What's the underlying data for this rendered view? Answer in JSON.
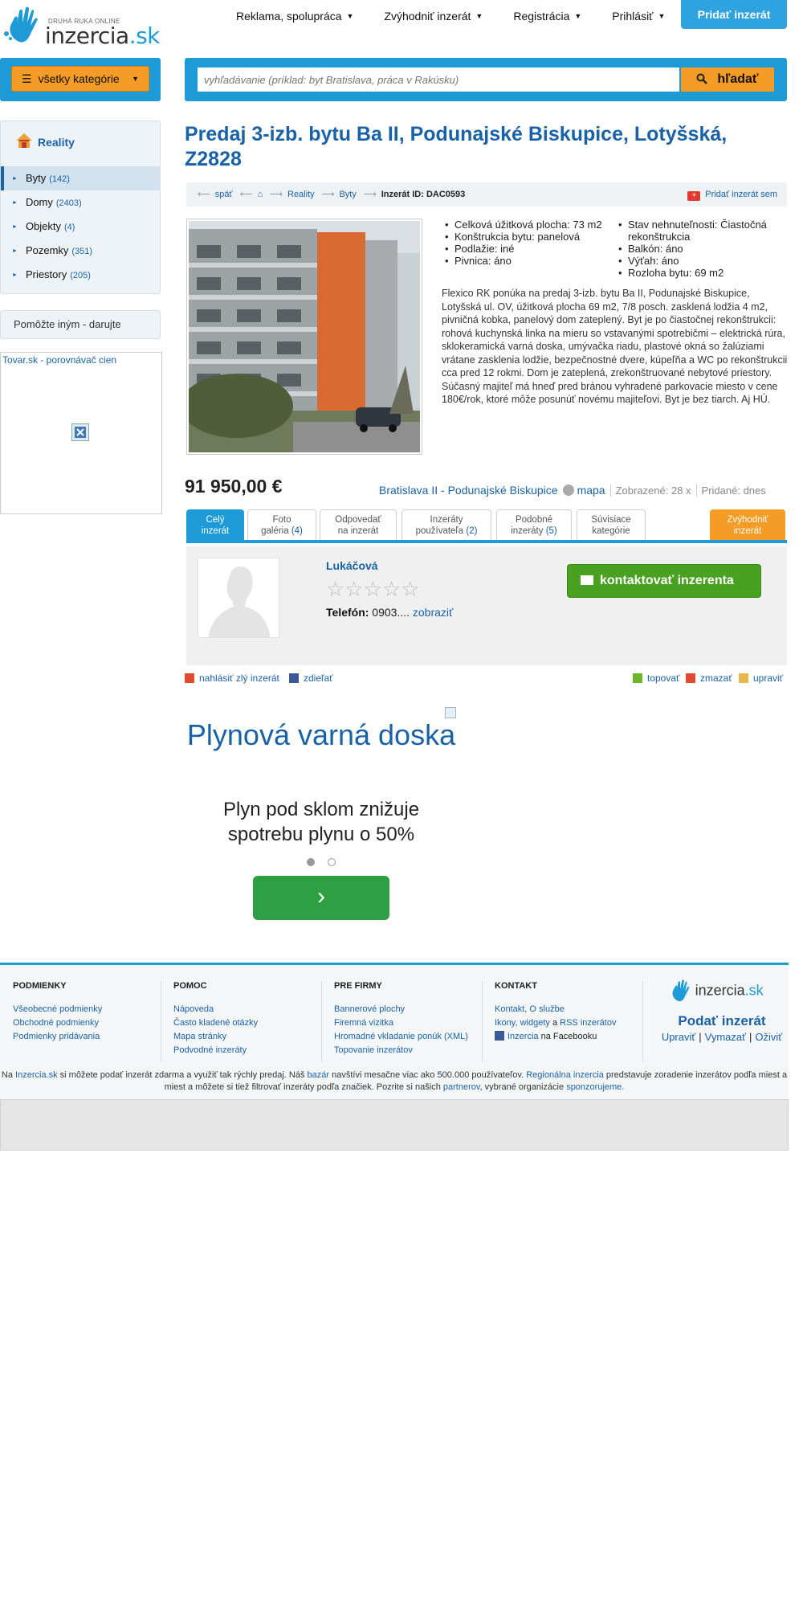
{
  "logo": {
    "tagline": "DRUHÁ RUKA ONLINE",
    "name": "inzercia",
    "tld": ".sk"
  },
  "nav": {
    "items": [
      {
        "label": "Reklama, spolupráca"
      },
      {
        "label": "Zvýhodniť inzerát"
      },
      {
        "label": "Registrácia"
      },
      {
        "label": "Prihlásiť"
      }
    ],
    "add_button": "Pridať inzerát"
  },
  "search": {
    "category_button": "všetky kategórie",
    "placeholder": "vyhľadávanie (príklad: byt Bratislava, práca v Rakúsku)",
    "button": "hľadať"
  },
  "sidebar": {
    "heading": "Reality",
    "items": [
      {
        "label": "Byty",
        "count": "(142)"
      },
      {
        "label": "Domy",
        "count": "(2403)"
      },
      {
        "label": "Objekty",
        "count": "(4)"
      },
      {
        "label": "Pozemky",
        "count": "(351)"
      },
      {
        "label": "Priestory",
        "count": "(205)"
      }
    ],
    "donate": "Pomôžte iným - darujte",
    "tovar_link": "Tovar.sk - porovnávač cien"
  },
  "listing": {
    "title": "Predaj 3-izb. bytu Ba II, Podunajské Biskupice, Lotyšská, Z2828",
    "breadcrumb": {
      "back": "späť",
      "home": "⌂",
      "reality": "Reality",
      "byty": "Byty",
      "id": "Inzerát ID: DAC0593",
      "add": "Pridať inzerát sem"
    },
    "params_left": [
      "Celková úžitková plocha: 73 m2",
      "Konštrukcia bytu: panelová",
      "Podlažie: iné",
      "Pivnica: áno"
    ],
    "params_right": [
      "Stav nehnuteľnosti: Čiastočná rekonštrukcia",
      "Balkón: áno",
      "Výťah: áno",
      "Rozloha bytu: 69 m2"
    ],
    "description": "Flexico RK ponúka na predaj 3-izb. bytu Ba II, Podunajské Biskupice, Lotyšská ul. OV, úžitková plocha 69 m2, 7/8 posch. zasklená lodžia 4 m2, pivničná kobka, panelový dom zateplený. Byt je po čiastočnej rekonštrukcii: rohová kuchynská linka na mieru so vstavanými spotrebičmi – elektrická rúra, sklokeramická varná doska, umývačka riadu, plastové okná so žalúziami vrátane zasklenia lodžie, bezpečnostné dvere, kúpeľňa a WC po rekonštrukcii cca pred 12 rokmi. Dom je zateplená, zrekonštruované nebytové priestory. Súčasný majiteľ má hneď pred bránou vyhradené parkovacie miesto v cene 180€/rok, ktoré môže posunúť novému majiteľovi. Byt je bez tiarch. Aj HÚ.",
    "price": "91 950,00 €",
    "location": "Bratislava II - Podunajské Biskupice",
    "map": "mapa",
    "views": "Zobrazené: 28 x",
    "added": "Pridané: dnes"
  },
  "tabs": [
    {
      "line1": "Celý",
      "line2": "inzerát",
      "count": ""
    },
    {
      "line1": "Foto",
      "line2": "galéria ",
      "count": "(4)"
    },
    {
      "line1": "Odpovedať",
      "line2": "na inzerát",
      "count": ""
    },
    {
      "line1": "Inzeráty",
      "line2": "používateľa ",
      "count": "(2)"
    },
    {
      "line1": "Podobné",
      "line2": "inzeráty ",
      "count": "(5)"
    },
    {
      "line1": "Súvisiace",
      "line2": "kategórie",
      "count": ""
    },
    {
      "line1": "Zvýhodniť",
      "line2": "inzerát",
      "count": ""
    }
  ],
  "seller": {
    "name": "Lukáčová",
    "stars": "☆☆☆☆☆",
    "phone_label": "Telefón:",
    "phone_value": "0903....",
    "phone_show": "zobraziť",
    "contact_button": "kontaktovať inzerenta"
  },
  "actions": {
    "report": "nahlásiť zlý inzerát",
    "share": "zdieľať",
    "top": "topovať",
    "delete": "zmazať",
    "edit": "upraviť"
  },
  "ad": {
    "title": "Plynová varná doska",
    "subtitle": "Plyn pod sklom znižuje spotrebu plynu o 50%",
    "arrow": "›"
  },
  "footer": {
    "columns": [
      {
        "heading": "PODMIENKY",
        "links": [
          "Všeobecné podmienky",
          "Obchodné podmienky",
          "Podmienky pridávania"
        ]
      },
      {
        "heading": "POMOC",
        "links": [
          "Nápoveda",
          "Často kladené otázky",
          "Mapa stránky",
          "Podvodné inzeráty"
        ]
      },
      {
        "heading": "PRE FIRMY",
        "links": [
          "Bannerové plochy",
          "Firemná vizitka",
          "Hromadné vkladanie ponúk (XML)",
          "Topovanie inzerátov"
        ]
      },
      {
        "heading": "KONTAKT",
        "links": [
          "Kontakt, O službe",
          "Ikony, widgety",
          "a",
          "RSS inzerátov",
          "Inzercia",
          "na Facebooku"
        ]
      }
    ],
    "cta": "Podať inzerát",
    "mini": [
      "Upraviť",
      "Vymazať",
      "Oživiť"
    ],
    "note": {
      "p1": "Na ",
      "site": "Inzercia.sk",
      "p2": " si môžete podať inzerát zdarma a využiť tak rýchly predaj. Náš ",
      "bazar": "bazár",
      "p3": " navštívi mesačne viac ako 500.000 používateľov. ",
      "regional": "Regionálna inzercia",
      "p4": " predstavuje zoradenie inzerátov podľa miest a miest a môžete si tiež filtrovať inzeráty podľa značiek. Pozrite si našich ",
      "partners": "partnerov",
      "p5": ", vybrané organizácie ",
      "sponsor": "sponzorujeme",
      "p6": "."
    }
  },
  "colors": {
    "brand_blue": "#1e9bd7",
    "link_blue": "#1a62a8",
    "orange": "#f49c26",
    "green": "#4aa020"
  }
}
